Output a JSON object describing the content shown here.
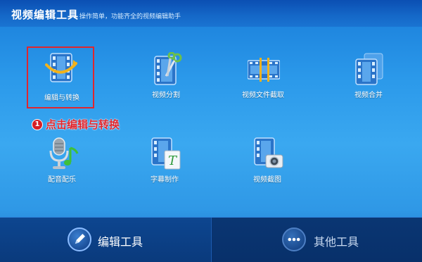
{
  "titlebar": {
    "title": "视频编辑工具",
    "subtitle": "操作简单，功能齐全的视频编辑助手"
  },
  "tools": [
    {
      "label": "编辑与转换",
      "icon": "film-convert-icon",
      "selected": true
    },
    {
      "label": "视频分割",
      "icon": "film-scissors-icon"
    },
    {
      "label": "视频文件截取",
      "icon": "film-strip-trim-icon"
    },
    {
      "label": "视频合并",
      "icon": "film-merge-icon"
    },
    {
      "label": "配音配乐",
      "icon": "microphone-music-icon"
    },
    {
      "label": "字幕制作",
      "icon": "film-subtitle-icon"
    },
    {
      "label": "视频截图",
      "icon": "film-camera-icon"
    }
  ],
  "callout": {
    "number": "1",
    "text": "点击编辑与转换",
    "color": "#e0262e"
  },
  "bottom_tabs": [
    {
      "label": "编辑工具",
      "icon": "pencil-icon",
      "active": true
    },
    {
      "label": "其他工具",
      "icon": "more-dots-icon",
      "active": false
    }
  ],
  "colors": {
    "selection_border": "#e0262e",
    "film_blue": "#2a74c9"
  }
}
